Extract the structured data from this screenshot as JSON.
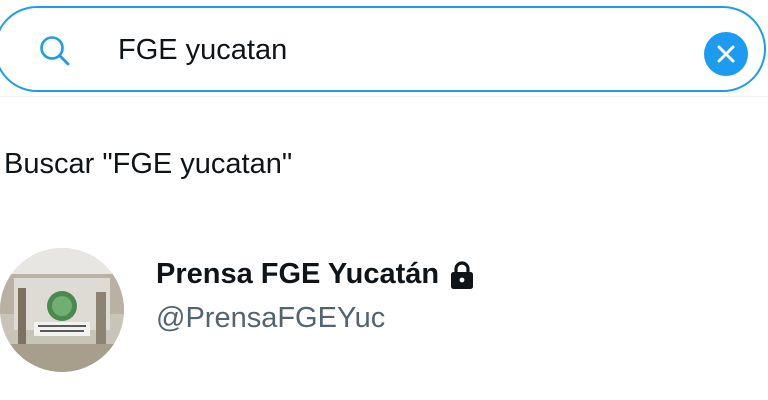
{
  "search": {
    "value": "FGE yucatan",
    "icon": "search-icon",
    "clear_icon": "close-icon",
    "accent_color": "#1d9bf0"
  },
  "suggestion": {
    "label": "Buscar \"FGE yucatan\""
  },
  "account": {
    "name": "Prensa FGE Yucatán",
    "handle": "@PrensaFGEYuc",
    "protected_icon": "lock-icon",
    "avatar_icon": "avatar"
  },
  "colors": {
    "text_primary": "#0f1419",
    "text_secondary": "#536471",
    "accent": "#1d9bf0"
  }
}
